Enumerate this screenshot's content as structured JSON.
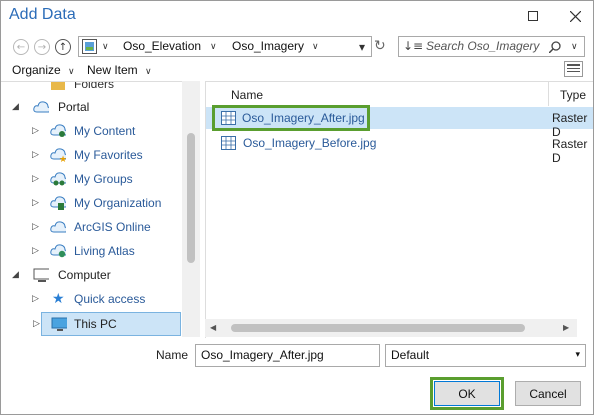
{
  "window": {
    "title": "Add Data"
  },
  "address": {
    "segments": [
      "Oso_Elevation",
      "Oso_Imagery"
    ]
  },
  "search": {
    "placeholder": "Search Oso_Imagery"
  },
  "toolbar": {
    "organize": "Organize",
    "new_item": "New Item"
  },
  "tree": {
    "top_cut": "Folders",
    "items": [
      {
        "label": "Portal",
        "icon": "portal-cloud-icon",
        "arrow": "expanded"
      },
      {
        "label": "My Content",
        "icon": "my-content-icon",
        "arrow": "collapsed"
      },
      {
        "label": "My Favorites",
        "icon": "my-favorites-icon",
        "arrow": "collapsed"
      },
      {
        "label": "My Groups",
        "icon": "my-groups-icon",
        "arrow": "collapsed"
      },
      {
        "label": "My Organization",
        "icon": "my-organization-icon",
        "arrow": "collapsed"
      },
      {
        "label": "ArcGIS Online",
        "icon": "arcgis-online-icon",
        "arrow": "collapsed"
      },
      {
        "label": "Living Atlas",
        "icon": "living-atlas-icon",
        "arrow": "collapsed"
      },
      {
        "label": "Computer",
        "icon": "computer-icon",
        "arrow": "expanded"
      },
      {
        "label": "Quick access",
        "icon": "star-icon",
        "arrow": "collapsed"
      },
      {
        "label": "This PC",
        "icon": "monitor-icon",
        "arrow": "collapsed"
      }
    ]
  },
  "files": {
    "columns": {
      "name": "Name",
      "type": "Type"
    },
    "rows": [
      {
        "name": "Oso_Imagery_After.jpg",
        "type": "Raster D",
        "selected": true
      },
      {
        "name": "Oso_Imagery_Before.jpg",
        "type": "Raster D",
        "selected": false
      }
    ]
  },
  "footer": {
    "name_label": "Name",
    "name_value": "Oso_Imagery_After.jpg",
    "filter_value": "Default",
    "ok_label": "OK",
    "cancel_label": "Cancel"
  },
  "colors": {
    "accent_title": "#2b6cb8",
    "selection": "#cce4f7",
    "highlight_border": "#5a9e2f"
  }
}
